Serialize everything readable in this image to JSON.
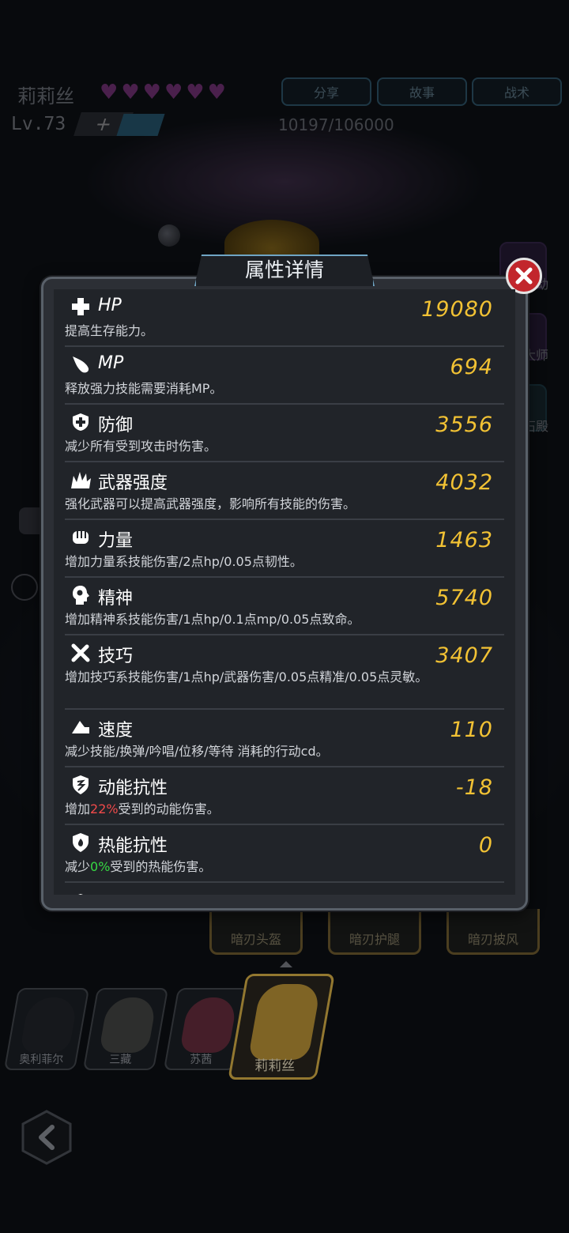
{
  "header": {
    "character_name": "莉莉丝",
    "hearts": 6,
    "level": "Lv.73",
    "plus": "+",
    "exp": "10197/106000",
    "buttons": {
      "share": "分享",
      "story": "故事",
      "tactics": "战术"
    }
  },
  "right_skills": [
    "暴动",
    "大师",
    "石殿"
  ],
  "dialog": {
    "title": "属性详情",
    "attributes": [
      {
        "icon": "plus-icon",
        "name": "HP",
        "value": "19080",
        "desc": "提高生存能力。"
      },
      {
        "icon": "mp-drop-icon",
        "name": "MP",
        "value": "694",
        "desc": "释放强力技能需要消耗MP。"
      },
      {
        "icon": "shield-icon",
        "name": "防御",
        "value": "3556",
        "desc": "减少所有受到攻击时伤害。"
      },
      {
        "icon": "explosion-icon",
        "name": "武器强度",
        "value": "4032",
        "desc": "强化武器可以提高武器强度，影响所有技能的伤害。"
      },
      {
        "icon": "fist-icon",
        "name": "力量",
        "value": "1463",
        "desc": "增加力量系技能伤害/2点hp/0.05点韧性。"
      },
      {
        "icon": "brain-icon",
        "name": "精神",
        "value": "5740",
        "desc": "增加精神系技能伤害/1点hp/0.1点mp/0.05点致命。"
      },
      {
        "icon": "tools-icon",
        "name": "技巧",
        "value": "3407",
        "desc": "增加技巧系技能伤害/1点hp/武器伤害/0.05点精准/0.05点灵敏。"
      },
      {
        "icon": "speed-icon",
        "name": "速度",
        "value": "110",
        "desc": "减少技能/换弹/吟唱/位移/等待 消耗的行动cd。"
      },
      {
        "icon": "kinetic-resist-icon",
        "name": "动能抗性",
        "value": "-18",
        "desc_prefix": "增加",
        "desc_pct": "22%",
        "desc_suffix": "受到的动能伤害。"
      },
      {
        "icon": "fire-resist-icon",
        "name": "热能抗性",
        "value": "0",
        "desc_prefix": "减少",
        "desc_pct": "0%",
        "desc_suffix": "受到的热能伤害。"
      }
    ]
  },
  "equipment": [
    "暗刃头盔",
    "暗刃护腿",
    "暗刃披风"
  ],
  "characters": [
    "奥利菲尔",
    "三藏",
    "苏茜",
    "莉莉丝"
  ],
  "colors": {
    "value": "#f2c234",
    "negative_pct": "#f04a4a",
    "positive_pct": "#36d843",
    "close": "#c2262c"
  }
}
